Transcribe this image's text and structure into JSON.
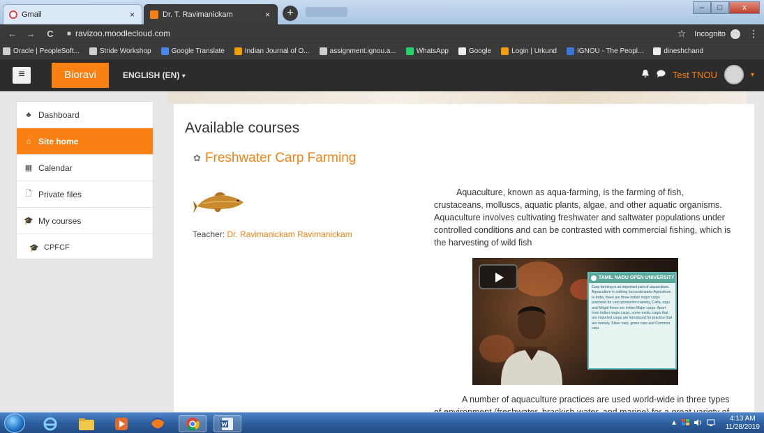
{
  "tabs": [
    {
      "title": "Gmail",
      "close": "×"
    },
    {
      "title": "Dr. T. Ravimanickam",
      "close": "×"
    }
  ],
  "newtab": "+",
  "window_controls": {
    "min": "–",
    "max": "□",
    "close": "x"
  },
  "address_bar": {
    "back": "←",
    "forward": "→",
    "reload": "C",
    "url": "ravizoo.moodlecloud.com",
    "star": "☆",
    "incognito_label": "Incognito",
    "menu": "⋮"
  },
  "bookmarks": [
    {
      "label": "Oracle | PeopleSoft...",
      "color": "#cfcfcf"
    },
    {
      "label": "Stride Workshop",
      "color": "#cfcfcf"
    },
    {
      "label": "Google Translate",
      "color": "#4a86e8"
    },
    {
      "label": "Indian Journal of O...",
      "color": "#f0a000"
    },
    {
      "label": "assignment.ignou.a...",
      "color": "#cfcfcf"
    },
    {
      "label": "WhatsApp",
      "color": "#25d366"
    },
    {
      "label": "Google",
      "color": "#eeeeee"
    },
    {
      "label": "Login | Urkund",
      "color": "#f39c12"
    },
    {
      "label": "IGNOU - The Peopl...",
      "color": "#3c78d8"
    },
    {
      "label": "dineshchand",
      "color": "#eeeeee"
    }
  ],
  "navbar": {
    "menu_icon": "≡",
    "brand": "Bioravi",
    "language": "ENGLISH (EN)",
    "language_caret": "▾",
    "bell": "🔔",
    "chat": "●",
    "user_name": "Test TNOU",
    "user_caret": "▾"
  },
  "sidebar": {
    "items": [
      {
        "label": "Dashboard",
        "icon": "♣"
      },
      {
        "label": "Site home",
        "icon": "⌂"
      },
      {
        "label": "Calendar",
        "icon": "▦"
      },
      {
        "label": "Private files",
        "icon": "🗋"
      },
      {
        "label": "My courses",
        "icon": "🎓"
      },
      {
        "label": "CPFCF",
        "icon": "🎓"
      }
    ]
  },
  "main": {
    "heading": "Available courses",
    "course_title": "Freshwater Carp Farming",
    "course_icon": "✿",
    "teacher_label": "Teacher:",
    "teacher_name": "Dr. Ravimanickam Ravimanickam",
    "summary": "Aquaculture, known as aqua-farming, is the farming of fish, crustaceans, molluscs, aquatic plants, algae, and other aquatic organisms. Aquaculture involves cultivating freshwater and saltwater populations under controlled conditions and can be contrasted with commercial fishing, which is the harvesting of wild fish",
    "video_card_title": "TAMIL NADU OPEN UNIVERSITY",
    "video_card_text": "Carp farming is an important part of aquaculture. Aquaculture is nothing but underwater Agriculture. In India, there are three indian major carps practised for carp production namely, Catla, rogu and Mrigal these are indian Major carps. Apart from Indian major carps, some exotic carps that are imported carps are introduced for practice that are namely, Silver carp, grass carp and Common carp.",
    "more_text": "A number of aquaculture practices are used world-wide in three types of environment (freshwater, brackish water, and marine) for a great variety of"
  },
  "taskbar": {
    "time": "4:13 AM",
    "date": "11/28/2019",
    "tray": "▲"
  }
}
